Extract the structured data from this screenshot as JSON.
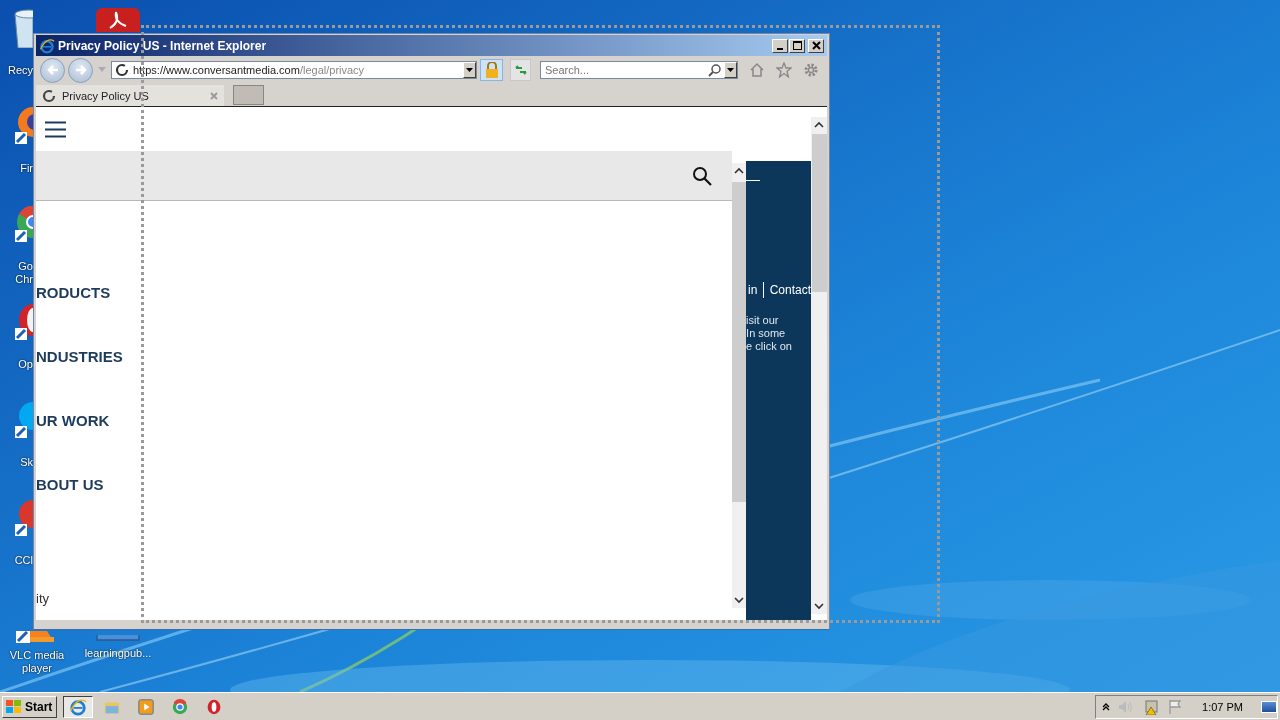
{
  "desktop_icons": [
    {
      "kind": "recycle-bin",
      "label_lines": [
        "Recy"
      ]
    },
    {
      "kind": "firefox",
      "label_lines": [
        "Fir"
      ]
    },
    {
      "kind": "chrome",
      "label_lines": [
        "Go",
        "Chr"
      ]
    },
    {
      "kind": "opera",
      "label_lines": [
        "Op"
      ]
    },
    {
      "kind": "skype",
      "label_lines": [
        "Sk"
      ]
    },
    {
      "kind": "ccleaner",
      "label_lines": [
        "CCl"
      ]
    },
    {
      "kind": "vlc",
      "label_lines": [
        "VLC media",
        "player"
      ]
    }
  ],
  "desktop_icons_2": [
    {
      "kind": "acrobat"
    },
    {
      "kind": "folder",
      "label_lines": [
        "learningpub..."
      ]
    }
  ],
  "window": {
    "title": "Privacy Policy US - Internet Explorer"
  },
  "address_bar": {
    "url_host": "https://www.conversantmedia.com",
    "url_path": "/legal/privacy"
  },
  "search": {
    "placeholder": "Search..."
  },
  "tabs": [
    {
      "label": "Privacy Policy US",
      "selected": true
    }
  ],
  "page": {
    "nav": [
      "RODUCTS",
      "NDUSTRIES",
      "UR WORK",
      "BOUT US"
    ],
    "footer_text": "ity",
    "panel": {
      "links": [
        "in",
        "Contact"
      ],
      "text_lines": [
        "isit our",
        "In some",
        "e click on"
      ]
    }
  },
  "taskbar": {
    "start": "Start",
    "apps": [
      {
        "kind": "ie",
        "selected": true
      },
      {
        "kind": "explorer",
        "selected": false
      },
      {
        "kind": "media",
        "selected": false
      },
      {
        "kind": "chrome",
        "selected": false
      },
      {
        "kind": "opera",
        "selected": false
      }
    ],
    "clock": "1:07 PM"
  }
}
